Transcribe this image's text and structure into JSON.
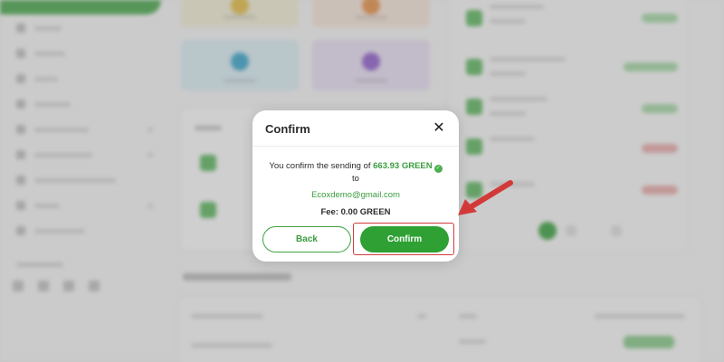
{
  "modal": {
    "title": "Confirm",
    "close_glyph": "✕",
    "message_prefix": "You confirm the sending of ",
    "amount": "663.93 GREEN",
    "verified_glyph": "✓",
    "to_label": "to",
    "recipient": "Ecoxdemo@gmail.com",
    "fee_text": "Fee: 0.00 GREEN",
    "back_label": "Back",
    "confirm_label": "Confirm"
  },
  "icons": {
    "close": "close-icon",
    "verified": "check-circle-icon",
    "annotation_arrow": "arrow-icon"
  },
  "colors": {
    "brand_green": "#2ea034",
    "green_text": "#3a9c3e",
    "annotation_red": "#d23a3a",
    "overlay": "rgba(130,130,130,0.36)"
  }
}
